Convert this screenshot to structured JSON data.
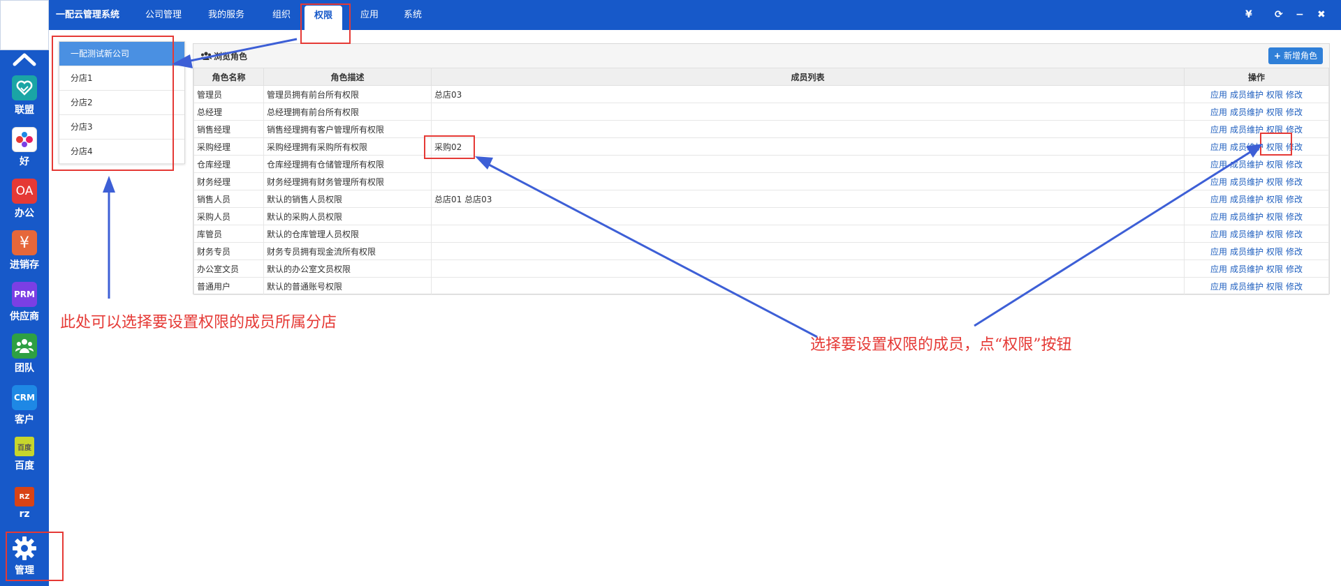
{
  "app": {
    "title": "一配云管理系统"
  },
  "topnav": [
    "公司管理",
    "我的服务",
    "组织",
    "权限",
    "应用",
    "系统"
  ],
  "top_icons": {
    "currency": "¥",
    "refresh": "⟳",
    "minimize": "−",
    "close": "✖"
  },
  "rail": [
    {
      "label": "联盟",
      "icon": "handshake-icon",
      "color": "#1aa5a5"
    },
    {
      "label": "好",
      "icon": "hao-icon",
      "color": "#ffffff"
    },
    {
      "label": "办公",
      "text": "OA",
      "icon": "oa-icon",
      "color": "#e53935"
    },
    {
      "label": "进销存",
      "text": "¥",
      "icon": "yen-icon",
      "color": "#e6673a"
    },
    {
      "label": "供应商",
      "text": "PRM",
      "icon": "prm-icon",
      "color": "#7b3fe4"
    },
    {
      "label": "团队",
      "icon": "team-icon",
      "color": "#2ea043"
    },
    {
      "label": "客户",
      "text": "CRM",
      "icon": "crm-icon",
      "color": "#1e88e5"
    },
    {
      "label": "百度",
      "text": "百度",
      "icon": "baidu-icon",
      "color": "#c7d62c"
    },
    {
      "label": "rz",
      "text": "RZ",
      "icon": "rz-icon",
      "color": "#d84315"
    },
    {
      "label": "管理",
      "icon": "gear-icon",
      "color": "#1759c9"
    }
  ],
  "branches": [
    "一配测试新公司",
    "分店1",
    "分店2",
    "分店3",
    "分店4"
  ],
  "panel": {
    "title": "浏览角色",
    "add_button": "新增角色",
    "columns": [
      "角色名称",
      "角色描述",
      "成员列表",
      "操作"
    ],
    "ops": [
      "应用",
      "成员维护",
      "权限",
      "修改"
    ],
    "rows": [
      {
        "name": "管理员",
        "desc": "管理员拥有前台所有权限",
        "members": "总店03"
      },
      {
        "name": "总经理",
        "desc": "总经理拥有前台所有权限",
        "members": ""
      },
      {
        "name": "销售经理",
        "desc": "销售经理拥有客户管理所有权限",
        "members": ""
      },
      {
        "name": "采购经理",
        "desc": "采购经理拥有采购所有权限",
        "members": "采购02"
      },
      {
        "name": "仓库经理",
        "desc": "仓库经理拥有仓储管理所有权限",
        "members": ""
      },
      {
        "name": "财务经理",
        "desc": "财务经理拥有财务管理所有权限",
        "members": ""
      },
      {
        "name": "销售人员",
        "desc": "默认的销售人员权限",
        "members": "总店01 总店03"
      },
      {
        "name": "采购人员",
        "desc": "默认的采购人员权限",
        "members": ""
      },
      {
        "name": "库管员",
        "desc": "默认的仓库管理人员权限",
        "members": ""
      },
      {
        "name": "财务专员",
        "desc": "财务专员拥有现金流所有权限",
        "members": ""
      },
      {
        "name": "办公室文员",
        "desc": "默认的办公室文员权限",
        "members": ""
      },
      {
        "name": "普通用户",
        "desc": "默认的普通账号权限",
        "members": ""
      }
    ]
  },
  "annotations": {
    "left_note": "此处可以选择要设置权限的成员所属分店",
    "right_note": "选择要设置权限的成员，点“权限”按钮",
    "color": "#e53935",
    "arrow_color": "#3d5fd6"
  }
}
